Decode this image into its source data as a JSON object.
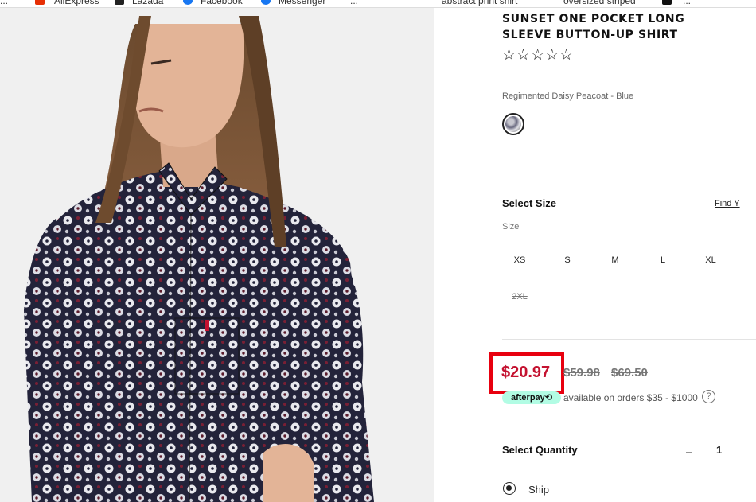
{
  "bookmarks": [
    {
      "label": "...",
      "icon": "bookmark-icon"
    },
    {
      "label": "AliExpress",
      "icon": "aliexpress-icon"
    },
    {
      "label": "Lazada",
      "icon": "lazada-icon"
    },
    {
      "label": "Facebook",
      "icon": "facebook-icon"
    },
    {
      "label": "Messenger",
      "icon": "messenger-icon"
    },
    {
      "label": "...",
      "icon": "bookmark-icon"
    },
    {
      "label": "abstract print shirt",
      "icon": "bookmark-icon"
    },
    {
      "label": "oversized striped",
      "icon": "bookmark-icon"
    },
    {
      "label": "...",
      "icon": "bookmark-icon"
    }
  ],
  "product": {
    "title": "SUNSET ONE POCKET LONG SLEEVE BUTTON-UP SHIRT",
    "rating_stars": "☆☆☆☆☆",
    "color_name": "Regimented Daisy Peacoat - Blue",
    "swatch_icon": "color-swatch-icon"
  },
  "size": {
    "heading": "Select Size",
    "find_link": "Find Y",
    "label": "Size",
    "options": [
      {
        "label": "XS",
        "available": true
      },
      {
        "label": "S",
        "available": true
      },
      {
        "label": "M",
        "available": true
      },
      {
        "label": "L",
        "available": true
      },
      {
        "label": "XL",
        "available": true
      },
      {
        "label": "2XL",
        "available": false
      }
    ]
  },
  "price": {
    "sale": "$20.97",
    "was_1": "$59.98",
    "was_2": "$69.50",
    "highlight_color": "#e8000f",
    "sale_color": "#c41230"
  },
  "afterpay": {
    "badge": "afterpay⟲",
    "text": "available on orders $35 - $1000",
    "help_icon": "question-icon",
    "help_glyph": "?"
  },
  "quantity": {
    "heading": "Select Quantity",
    "minus": "–",
    "value": "1"
  },
  "delivery": {
    "option_label": "Ship"
  }
}
